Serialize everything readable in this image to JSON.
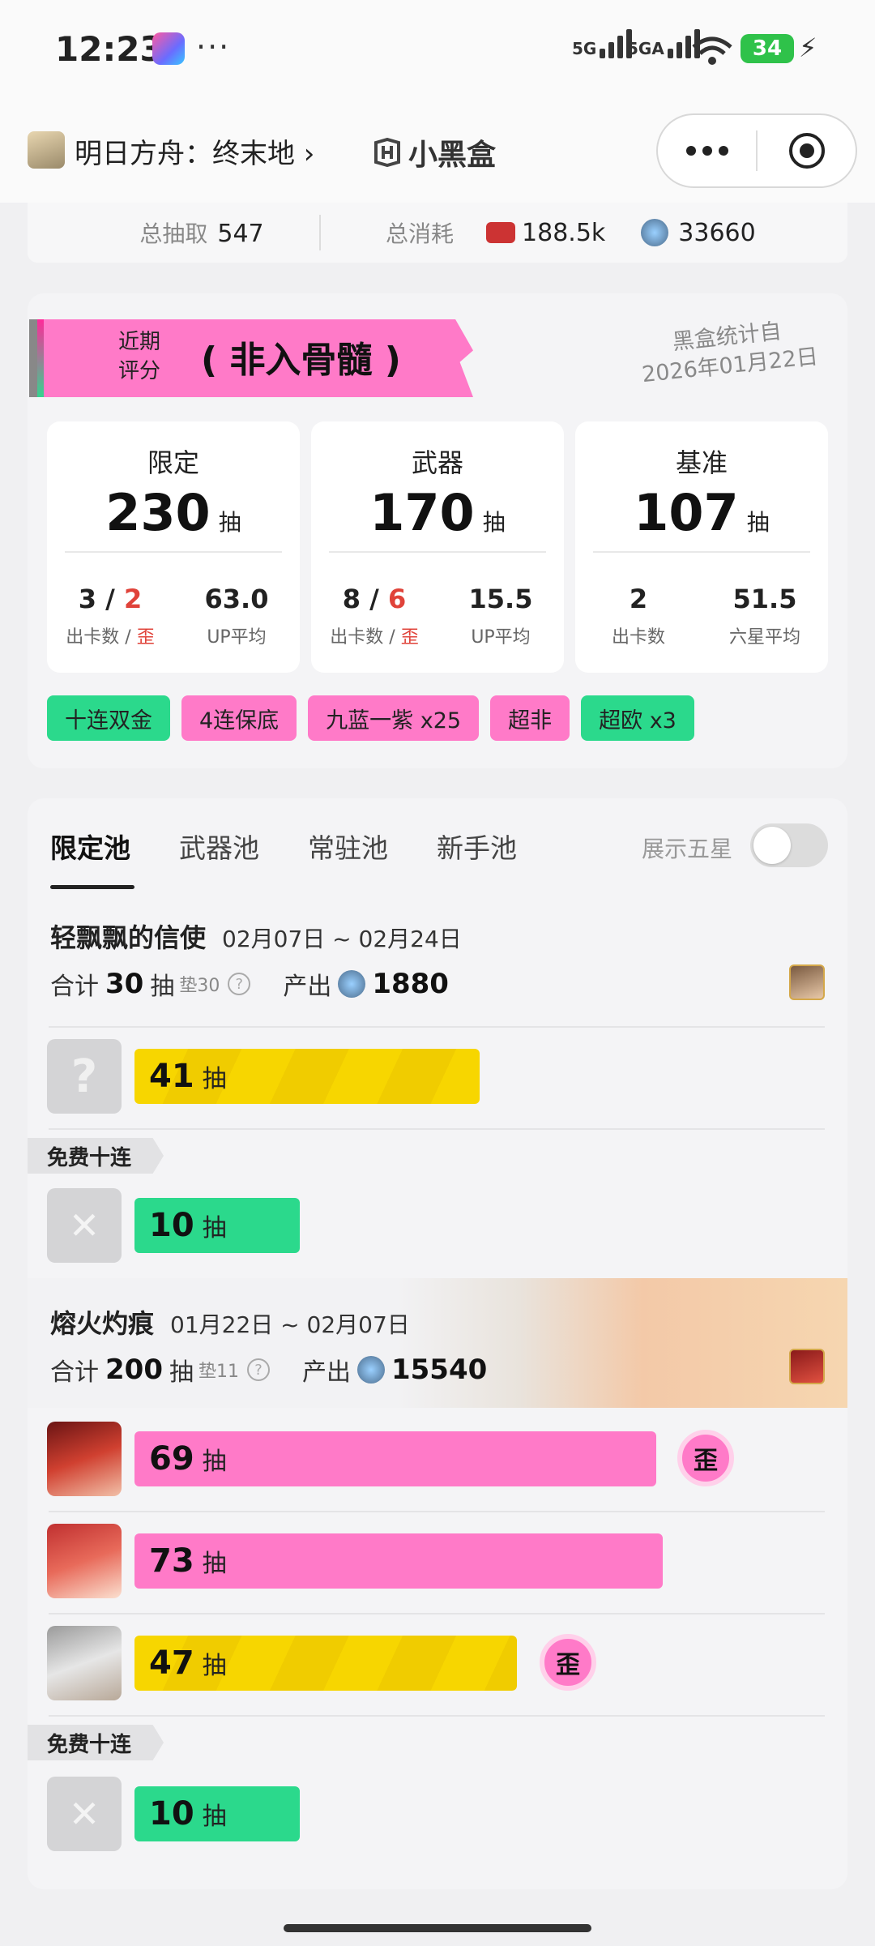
{
  "status": {
    "time": "12:23",
    "net1": "5G",
    "net2": "5GA",
    "battery": "34"
  },
  "header": {
    "title": "明日方舟：终末地",
    "brand": "小黑盒"
  },
  "summary": {
    "total_label": "总抽取",
    "total_value": "547",
    "cost_label": "总消耗",
    "cost_value1": "188.5k",
    "cost_value2": "33660"
  },
  "rating": {
    "label_line1": "近期",
    "label_line2": "评分",
    "value": "非入骨髓",
    "stamp_line1": "黑盒统计自",
    "stamp_line2": "2026年01月22日"
  },
  "stats": [
    {
      "title": "限定",
      "count": "230",
      "unit": "抽",
      "c1_a": "3",
      "c1_b": "2",
      "c1_lbl_a": "出卡数 / ",
      "c1_lbl_b": "歪",
      "c2_v": "63.0",
      "c2_l": "UP平均"
    },
    {
      "title": "武器",
      "count": "170",
      "unit": "抽",
      "c1_a": "8",
      "c1_b": "6",
      "c1_lbl_a": "出卡数 / ",
      "c1_lbl_b": "歪",
      "c2_v": "15.5",
      "c2_l": "UP平均"
    },
    {
      "title": "基准",
      "count": "107",
      "unit": "抽",
      "c1_v": "2",
      "c1_l": "出卡数",
      "c2_v": "51.5",
      "c2_l": "六星平均"
    }
  ],
  "tags": [
    "十连双金",
    "4连保底",
    "九蓝一紫 x25",
    "超非",
    "超欧 x3"
  ],
  "tabs": {
    "items": [
      "限定池",
      "武器池",
      "常驻池",
      "新手池"
    ],
    "toggle_label": "展示五星"
  },
  "pools": [
    {
      "name": "轻飘飘的信使",
      "dates": "02月07日 ~ 02月24日",
      "sum_label": "合计",
      "sum_value": "30",
      "sum_unit": "抽",
      "pad": "垫30",
      "out_label": "产出",
      "out_value": "1880"
    },
    {
      "name": "熔火灼痕",
      "dates": "01月22日 ~ 02月07日",
      "sum_label": "合计",
      "sum_value": "200",
      "sum_unit": "抽",
      "pad": "垫11",
      "out_label": "产出",
      "out_value": "15540"
    }
  ],
  "rows": [
    {
      "value": "41",
      "unit": "抽"
    },
    {
      "value": "10",
      "unit": "抽"
    },
    {
      "value": "69",
      "unit": "抽",
      "badge": "歪"
    },
    {
      "value": "73",
      "unit": "抽"
    },
    {
      "value": "47",
      "unit": "抽",
      "badge": "歪"
    },
    {
      "value": "10",
      "unit": "抽"
    }
  ],
  "free_label": "免费十连",
  "glyphs": {
    "qmark": "?",
    "cross": "✕",
    "help": "?"
  }
}
